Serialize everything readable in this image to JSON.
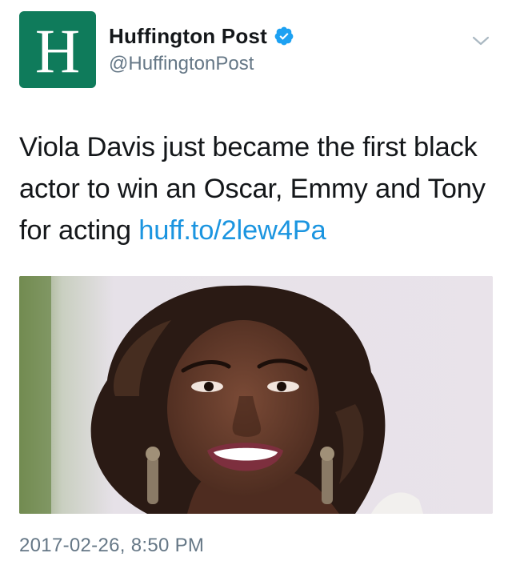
{
  "author": {
    "avatar_letter": "H",
    "display_name": "Huffington Post",
    "handle": "@HuffingtonPost",
    "verified": true,
    "avatar_color": "#0f7b5b"
  },
  "menu": {
    "icon": "chevron-down-icon"
  },
  "tweet": {
    "text": "Viola Davis just became the first black actor to win an Oscar, Emmy and Tony for acting ",
    "link": "huff.to/2lew4Pa",
    "link_color": "#1b95e0"
  },
  "media": {
    "icon": "photo"
  },
  "timestamp": "2017-02-26, 8:50 PM"
}
